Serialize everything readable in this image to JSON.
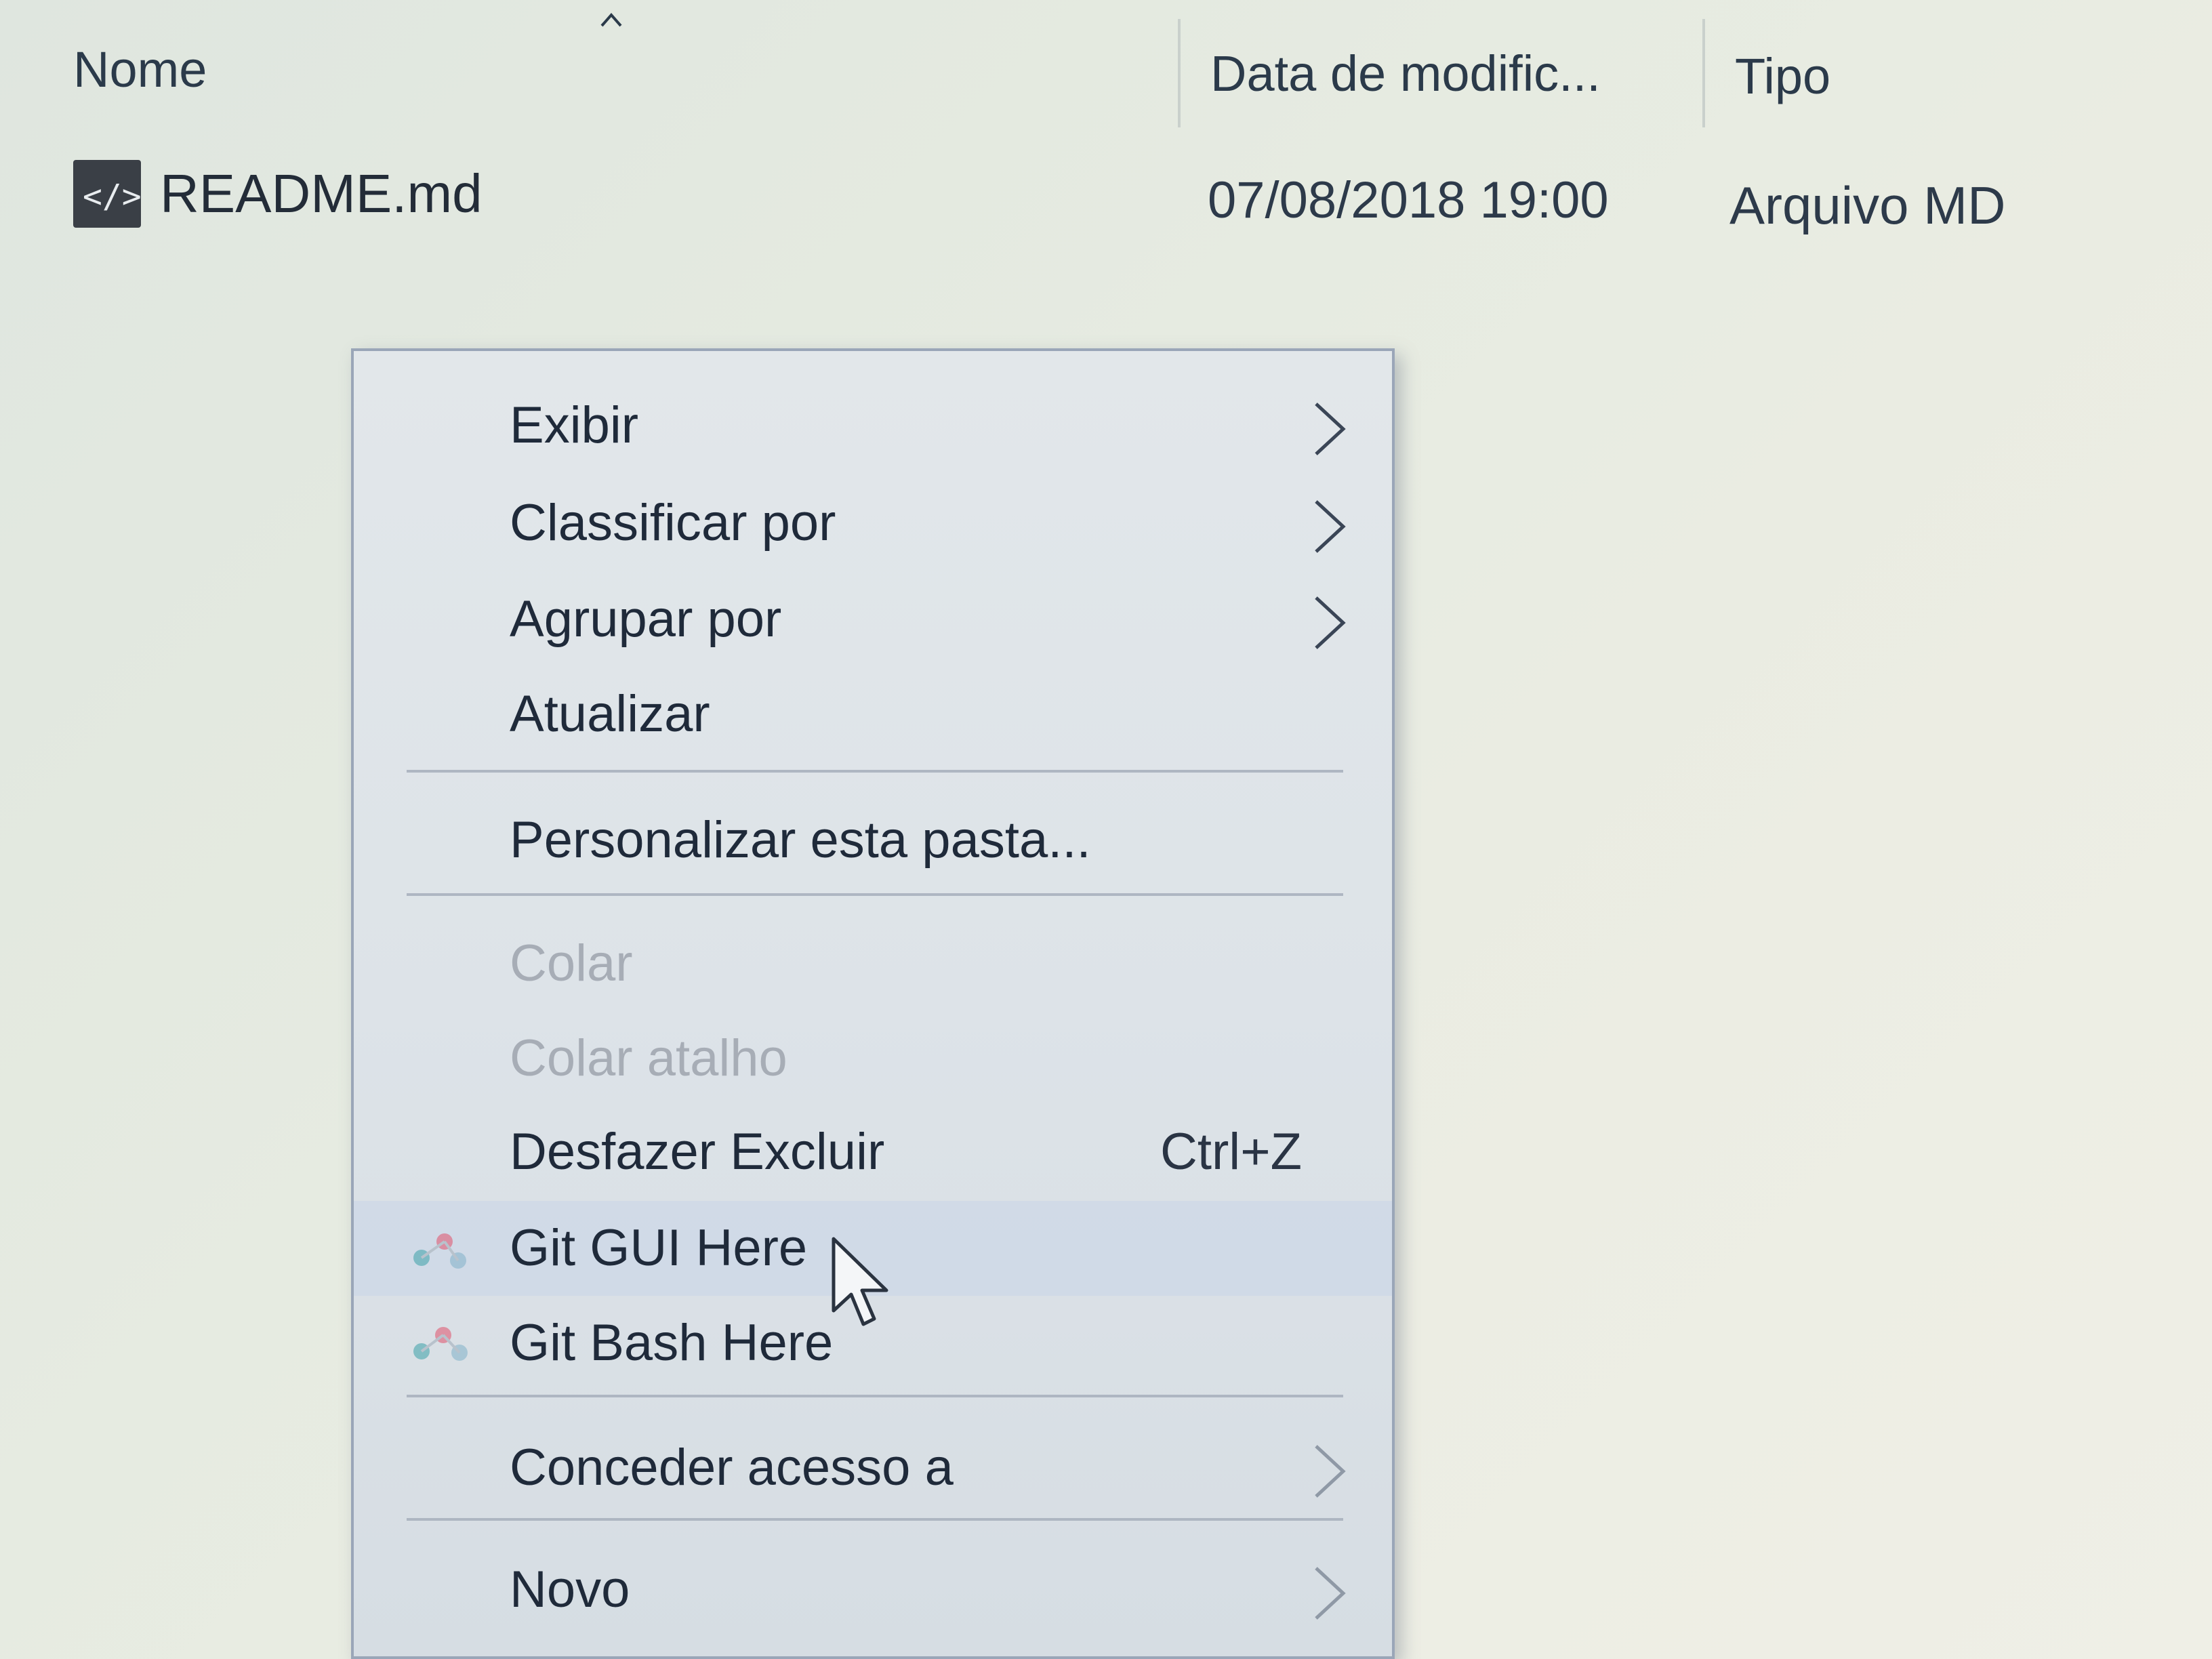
{
  "columns": {
    "name": "Nome",
    "date": "Data de modific...",
    "type": "Tipo",
    "sort_icon": "sort-ascending-icon"
  },
  "file": {
    "icon": "markdown-file-icon",
    "name": "README.md",
    "date": "07/08/2018 19:00",
    "type": "Arquivo MD"
  },
  "menu": {
    "items": [
      {
        "label": "Exibir",
        "submenu": true,
        "enabled": true
      },
      {
        "label": "Classificar por",
        "submenu": true,
        "enabled": true
      },
      {
        "label": "Agrupar por",
        "submenu": true,
        "enabled": true
      },
      {
        "label": "Atualizar",
        "submenu": false,
        "enabled": true
      },
      {
        "label": "Personalizar esta pasta...",
        "submenu": false,
        "enabled": true
      },
      {
        "label": "Colar",
        "submenu": false,
        "enabled": false
      },
      {
        "label": "Colar atalho",
        "submenu": false,
        "enabled": false
      },
      {
        "label": "Desfazer Excluir",
        "shortcut": "Ctrl+Z",
        "submenu": false,
        "enabled": true
      },
      {
        "label": "Git GUI Here",
        "icon": "git-gui-icon",
        "submenu": false,
        "enabled": true,
        "hovered": true
      },
      {
        "label": "Git Bash Here",
        "icon": "git-bash-icon",
        "submenu": false,
        "enabled": true
      },
      {
        "label": "Conceder acesso a",
        "submenu": true,
        "enabled": true
      },
      {
        "label": "Novo",
        "submenu": true,
        "enabled": true
      }
    ]
  },
  "colors": {
    "menu_bg": "#dde3e8",
    "menu_border": "#9aa6b8",
    "disabled_text": "#a7adb6",
    "git_red": "#e0506a",
    "git_teal": "#3aa0a8"
  }
}
